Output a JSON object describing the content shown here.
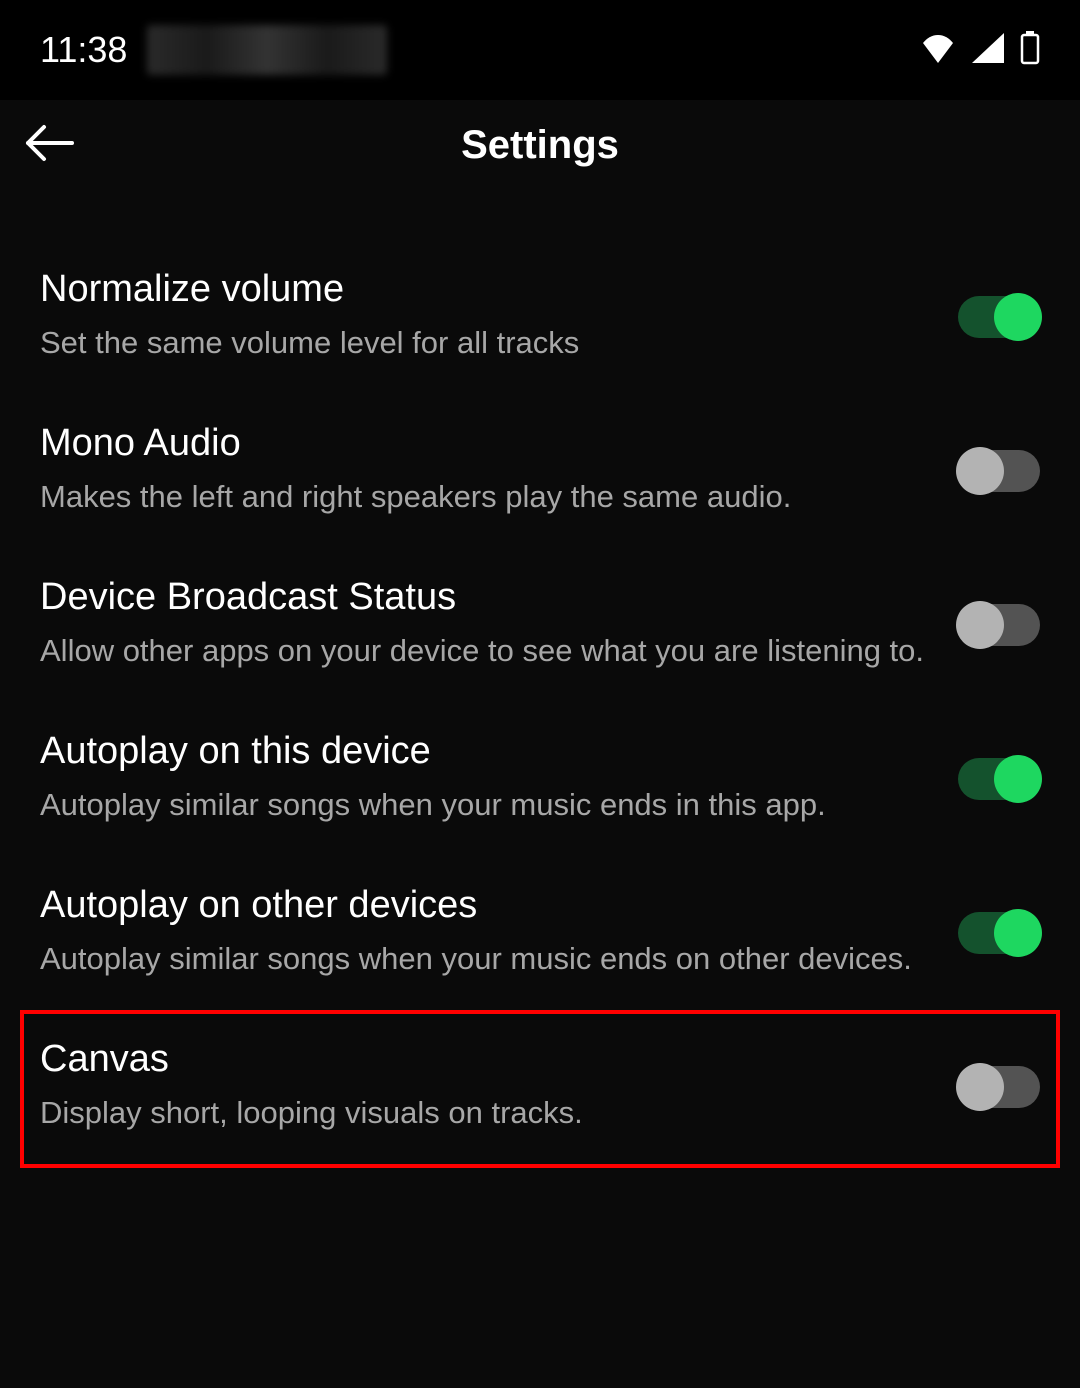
{
  "statusBar": {
    "time": "11:38"
  },
  "header": {
    "title": "Settings"
  },
  "settings": [
    {
      "title": "Normalize volume",
      "description": "Set the same volume level for all tracks",
      "enabled": true
    },
    {
      "title": "Mono Audio",
      "description": "Makes the left and right speakers play the same audio.",
      "enabled": false
    },
    {
      "title": "Device Broadcast Status",
      "description": "Allow other apps on your device to see what you are listening to.",
      "enabled": false
    },
    {
      "title": "Autoplay on this device",
      "description": "Autoplay similar songs when your music ends in this app.",
      "enabled": true
    },
    {
      "title": "Autoplay on other devices",
      "description": "Autoplay similar songs when your music ends on other devices.",
      "enabled": true
    },
    {
      "title": "Canvas",
      "description": "Display short, looping visuals on tracks.",
      "enabled": false
    }
  ]
}
